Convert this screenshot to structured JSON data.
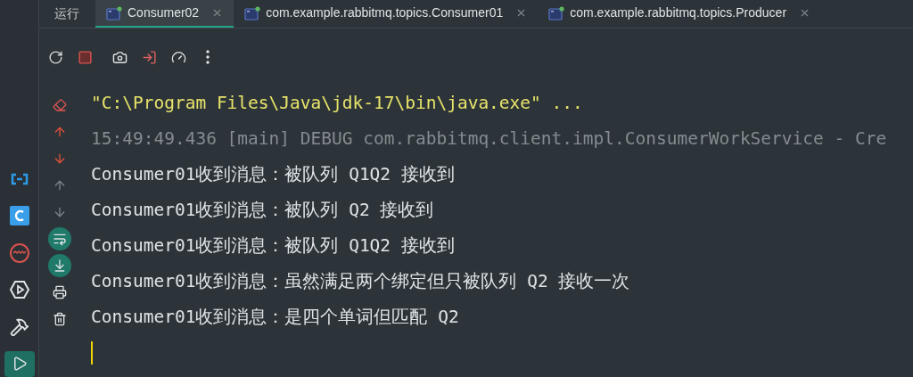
{
  "sidebar": {
    "items": [
      {
        "kind": "brackets",
        "selected": false
      },
      {
        "kind": "refresh-square",
        "selected": false
      },
      {
        "kind": "wave-circle",
        "selected": false
      },
      {
        "kind": "play-hexagon",
        "selected": false
      },
      {
        "kind": "hammer",
        "selected": false
      },
      {
        "kind": "run",
        "selected": true
      }
    ]
  },
  "run_panel": {
    "title": "运行",
    "tabs": [
      {
        "label": "Consumer02",
        "selected": true
      },
      {
        "label": "com.example.rabbitmq.topics.Consumer01",
        "selected": false
      },
      {
        "label": "com.example.rabbitmq.topics.Producer",
        "selected": false
      }
    ],
    "toolbar": [
      {
        "kind": "rerun"
      },
      {
        "kind": "stop"
      },
      {
        "kind": "camera"
      },
      {
        "kind": "exit"
      },
      {
        "kind": "gauge"
      },
      {
        "kind": "more"
      }
    ],
    "gutter": [
      {
        "kind": "clear",
        "on": false
      },
      {
        "kind": "prev-error",
        "on": false
      },
      {
        "kind": "next-error",
        "on": false
      },
      {
        "kind": "up",
        "on": false
      },
      {
        "kind": "down",
        "on": false
      },
      {
        "kind": "soft-wrap",
        "on": true
      },
      {
        "kind": "scroll-end",
        "on": true
      },
      {
        "kind": "print",
        "on": false
      },
      {
        "kind": "trash",
        "on": false
      }
    ],
    "console": [
      {
        "kind": "command",
        "text": "\"C:\\Program Files\\Java\\jdk-17\\bin\\java.exe\" ..."
      },
      {
        "kind": "debug",
        "text": "15:49:49.436 [main] DEBUG com.rabbitmq.client.impl.ConsumerWorkService - Cre"
      },
      {
        "kind": "output",
        "text": "Consumer01收到消息：被队列 Q1Q2 接收到"
      },
      {
        "kind": "output",
        "text": "Consumer01收到消息：被队列 Q2 接收到"
      },
      {
        "kind": "output",
        "text": "Consumer01收到消息：被队列 Q1Q2 接收到"
      },
      {
        "kind": "output",
        "text": "Consumer01收到消息：虽然满足两个绑定但只被队列 Q2 接收一次"
      },
      {
        "kind": "output",
        "text": "Consumer01收到消息：是四个单词但匹配 Q2"
      }
    ]
  }
}
